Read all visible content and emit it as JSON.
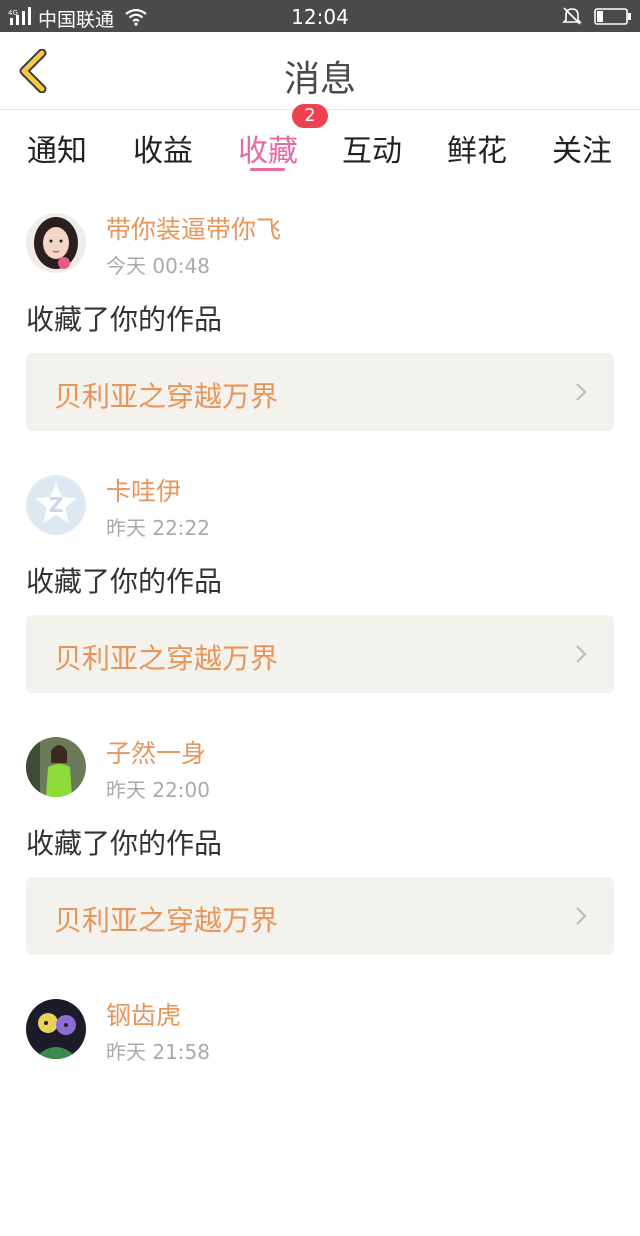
{
  "status_bar": {
    "carrier": "中国联通",
    "time": "12:04"
  },
  "nav": {
    "title": "消息"
  },
  "tabs": [
    {
      "label": "通知",
      "active": false
    },
    {
      "label": "收益",
      "active": false
    },
    {
      "label": "收藏",
      "active": true
    },
    {
      "label": "互动",
      "active": false
    },
    {
      "label": "鲜花",
      "active": false
    },
    {
      "label": "关注",
      "active": false
    }
  ],
  "tab_badge": "2",
  "messages": [
    {
      "username": "带你装逼带你飞",
      "time": "今天 00:48",
      "action": "收藏了你的作品",
      "work_title": "贝利亚之穿越万界",
      "avatar": "girl-avatar"
    },
    {
      "username": "卡哇伊",
      "time": "昨天 22:22",
      "action": "收藏了你的作品",
      "work_title": "贝利亚之穿越万界",
      "avatar": "default-z-avatar"
    },
    {
      "username": "子然一身",
      "time": "昨天 22:00",
      "action": "收藏了你的作品",
      "work_title": "贝利亚之穿越万界",
      "avatar": "green-coat-avatar"
    },
    {
      "username": "钢齿虎",
      "time": "昨天 21:58",
      "action": "",
      "work_title": "",
      "avatar": "anime-avatar"
    }
  ],
  "colors": {
    "accent_pink": "#e86aa0",
    "username_orange": "#e8955a",
    "badge_red": "#f0414f",
    "back_yellow": "#f4c84a",
    "card_bg": "#f3f2ed"
  }
}
